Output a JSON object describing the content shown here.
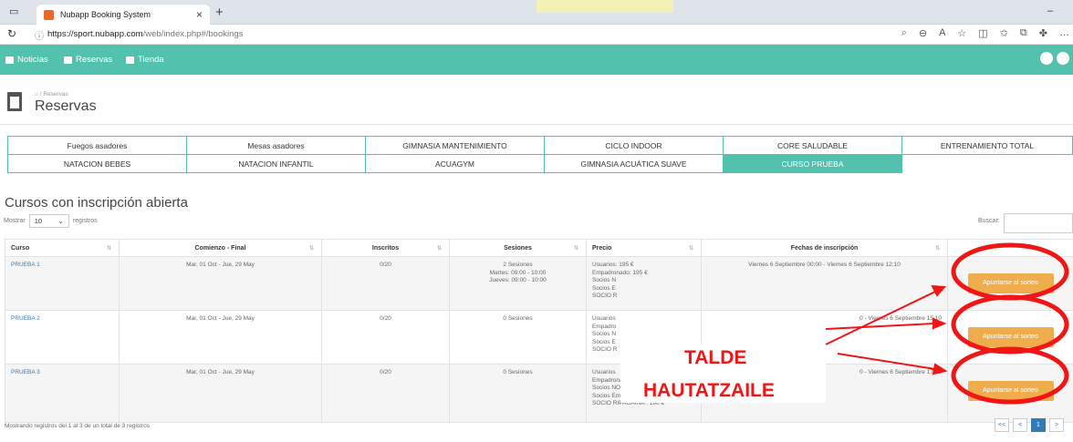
{
  "browser": {
    "tab_title": "Nubapp Booking System",
    "url_host": "https://sport.nubapp.com",
    "url_path": "/web/index.php#/bookings"
  },
  "nav": {
    "items": [
      "Noticias",
      "Reservas",
      "Tienda"
    ]
  },
  "page": {
    "breadcrumb": "Reservas",
    "title": "Reservas"
  },
  "categories": {
    "row1": [
      "Fuegos asadores",
      "Mesas asadores",
      "GIMNASIA MANTENIMIENTO",
      "CICLO INDOOR",
      "CORE SALUDABLE",
      "ENTRENAMIENTO TOTAL"
    ],
    "row2": [
      "NATACION BEBES",
      "NATACION INFANTIL",
      "ACUAGYM",
      "GIMNASIA ACUÁTICA SUAVE",
      "CURSO PRUEBA"
    ],
    "active": "CURSO PRUEBA"
  },
  "courses": {
    "heading": "Cursos con inscripción abierta",
    "show_label": "Mostrar",
    "page_size": "10",
    "records_label": "registros",
    "search_label": "Buscar:",
    "columns": [
      "Curso",
      "Comienzo - Final",
      "Inscritos",
      "Sesiones",
      "Precio",
      "Fechas de inscripción"
    ],
    "rows": [
      {
        "name": "PRUEBA 1",
        "dates": "Mar, 01 Oct - Jue, 29 May",
        "enrolled": "0/20",
        "sessions": [
          "2 Sesiones",
          "Martes: 09:00 - 10:00",
          "Jueves: 09:00 - 10:00"
        ],
        "prices": [
          "Usuarios: 195 €",
          "Empadronado: 195 €",
          "Socios N",
          "Socios E",
          "SOCIO R"
        ],
        "registration": "Viernes 6 Septiembre 00:00 - Viernes 6 Septiembre 12:10",
        "button": "Apuntarse al sorteo"
      },
      {
        "name": "PRUEBA 2",
        "dates": "Mar, 01 Oct - Jue, 29 May",
        "enrolled": "0/20",
        "sessions": [
          "0 Sesiones"
        ],
        "prices": [
          "Usuarios",
          "Empadro",
          "Socios N",
          "Socios E",
          "SOCIO R"
        ],
        "registration": "0 - Viernes 6 Septiembre 15:10",
        "button": "Apuntarse al sorteo"
      },
      {
        "name": "PRUEBA 3",
        "dates": "Mar, 01 Oct - Jue, 29 May",
        "enrolled": "0/20",
        "sessions": [
          "0 Sesiones"
        ],
        "prices": [
          "Usuarios",
          "Empadronado: 195 €",
          "Socios NO Empadronados: 180 €",
          "Socios Empadronados: 180 €",
          "SOCIO RIPAGAINA : 180 €"
        ],
        "registration": "0 - Viernes 6 Septiembre 17:10",
        "button": "Apuntarse al sorteo"
      }
    ],
    "info": "Mostrando registros del 1 al 3 de un total de 3 registros",
    "pager": [
      "<<",
      "<",
      "1",
      ">"
    ]
  },
  "annotation": {
    "line1": "TALDE",
    "line2": "HAUTATZAILE",
    "color": "#f01616"
  }
}
